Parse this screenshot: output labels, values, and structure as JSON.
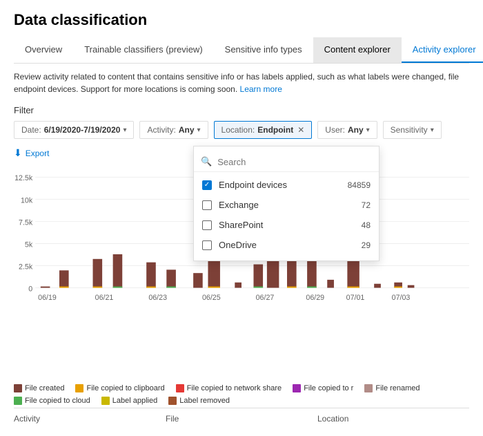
{
  "page": {
    "title": "Data classification"
  },
  "tabs": [
    {
      "id": "overview",
      "label": "Overview",
      "state": "normal"
    },
    {
      "id": "trainable",
      "label": "Trainable classifiers (preview)",
      "state": "normal"
    },
    {
      "id": "sensitive",
      "label": "Sensitive info types",
      "state": "normal"
    },
    {
      "id": "content-explorer",
      "label": "Content explorer",
      "state": "active"
    },
    {
      "id": "activity-explorer",
      "label": "Activity explorer",
      "state": "selected"
    }
  ],
  "description": {
    "text": "Review activity related to content that contains sensitive info or has labels applied, such as what labels were changed, file",
    "text2": "endpoint devices. Support for more locations is coming soon.",
    "learn_more": "Learn more"
  },
  "filter": {
    "label": "Filter",
    "date_label": "Date:",
    "date_value": "6/19/2020-7/19/2020",
    "activity_label": "Activity:",
    "activity_value": "Any",
    "location_label": "Location:",
    "location_value": "Endpoint",
    "user_label": "User:",
    "user_value": "Any",
    "sensitivity_label": "Sensitivity"
  },
  "export": {
    "label": "Export"
  },
  "dropdown": {
    "search_placeholder": "Search",
    "items": [
      {
        "id": "endpoint",
        "label": "Endpoint devices",
        "count": "84859",
        "checked": true
      },
      {
        "id": "exchange",
        "label": "Exchange",
        "count": "72",
        "checked": false
      },
      {
        "id": "sharepoint",
        "label": "SharePoint",
        "count": "48",
        "checked": false
      },
      {
        "id": "onedrive",
        "label": "OneDrive",
        "count": "29",
        "checked": false
      }
    ]
  },
  "chart": {
    "y_labels": [
      "12.5k",
      "10k",
      "7.5k",
      "5k",
      "2.5k",
      "0"
    ],
    "x_labels": [
      "06/19",
      "06/21",
      "06/23",
      "06/25",
      "06/27",
      "06/29",
      "07/01",
      "07/03"
    ],
    "bars": [
      {
        "date": "06/19",
        "value": 100,
        "height_pct": 1
      },
      {
        "date": "06/20",
        "value": 1200,
        "height_pct": 9.6
      },
      {
        "date": "06/21",
        "value": 2100,
        "height_pct": 16.8
      },
      {
        "date": "06/22",
        "value": 2600,
        "height_pct": 20.8
      },
      {
        "date": "06/23",
        "value": 1800,
        "height_pct": 14.4
      },
      {
        "date": "06/24",
        "value": 1200,
        "height_pct": 9.6
      },
      {
        "date": "06/25",
        "value": 1100,
        "height_pct": 8.8
      },
      {
        "date": "06/25b",
        "value": 7600,
        "height_pct": 60.8
      },
      {
        "date": "06/26",
        "value": 400,
        "height_pct": 3.2
      },
      {
        "date": "06/27",
        "value": 1700,
        "height_pct": 13.6
      },
      {
        "date": "06/27b",
        "value": 7800,
        "height_pct": 62.4
      },
      {
        "date": "06/28",
        "value": 2400,
        "height_pct": 19.2
      },
      {
        "date": "06/29",
        "value": 2300,
        "height_pct": 18.4
      },
      {
        "date": "06/30",
        "value": 600,
        "height_pct": 4.8
      },
      {
        "date": "07/01",
        "value": 5100,
        "height_pct": 40.8
      },
      {
        "date": "07/02",
        "value": 200,
        "height_pct": 1.6
      },
      {
        "date": "07/03",
        "value": 400,
        "height_pct": 3.2
      },
      {
        "date": "07/03b",
        "value": 150,
        "height_pct": 1.2
      }
    ]
  },
  "legend": [
    {
      "id": "file-created",
      "label": "File created",
      "color": "#7d4037"
    },
    {
      "id": "file-renamed",
      "label": "File renamed",
      "color": "#7d4037"
    },
    {
      "id": "file-copied-clipboard",
      "label": "File copied to clipboard",
      "color": "#e8a000"
    },
    {
      "id": "file-copied-cloud",
      "label": "File copied to cloud",
      "color": "#4caf50"
    },
    {
      "id": "file-copied-network",
      "label": "File copied to network share",
      "color": "#e53935"
    },
    {
      "id": "label-applied",
      "label": "Label applied",
      "color": "#c9b800"
    },
    {
      "id": "file-copied-r",
      "label": "File copied to r",
      "color": "#9c27b0"
    },
    {
      "id": "label-removed",
      "label": "Label removed",
      "color": "#a0522d"
    }
  ],
  "footer": {
    "col1": "Activity",
    "col2": "File",
    "col3": "Location"
  }
}
